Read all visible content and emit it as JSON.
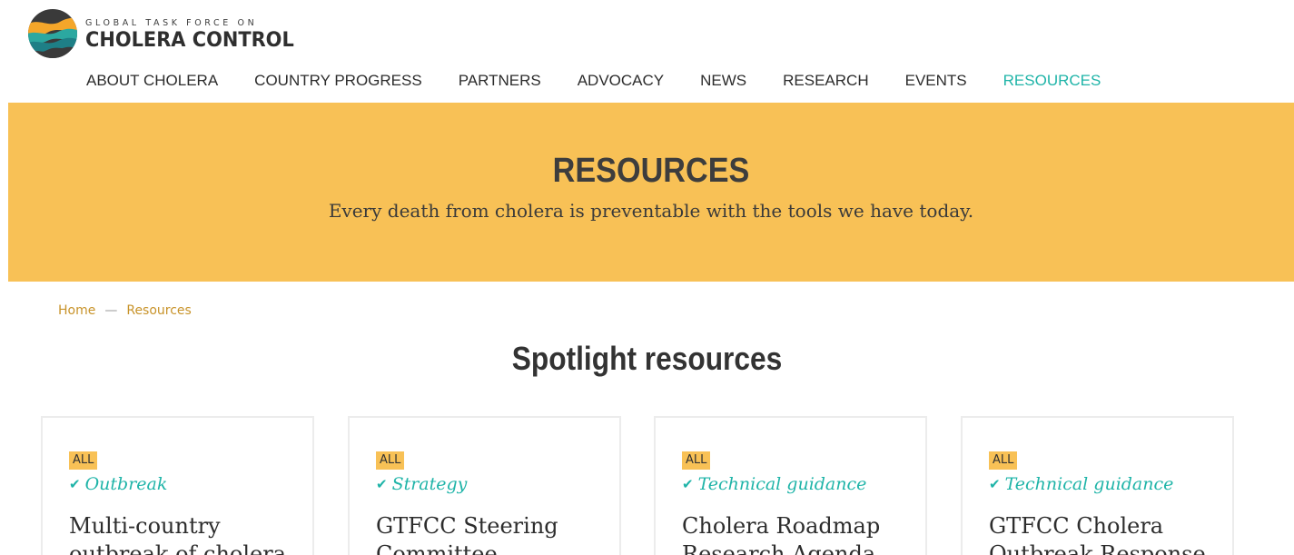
{
  "header": {
    "logo_small": "GLOBAL TASK FORCE ON",
    "logo_big": "CHOLERA CONTROL"
  },
  "nav": {
    "items": [
      {
        "label": "ABOUT CHOLERA"
      },
      {
        "label": "COUNTRY PROGRESS"
      },
      {
        "label": "PARTNERS"
      },
      {
        "label": "ADVOCACY"
      },
      {
        "label": "NEWS"
      },
      {
        "label": "RESEARCH"
      },
      {
        "label": "EVENTS"
      },
      {
        "label": "RESOURCES"
      }
    ],
    "active": "RESOURCES",
    "active_color": "#1fb4a8"
  },
  "hero": {
    "title": "RESOURCES",
    "subtitle": "Every death from cholera is preventable with the tools we have today.",
    "background": "#f8c156"
  },
  "breadcrumb": {
    "home": "Home",
    "separator": "—",
    "current": "Resources"
  },
  "section": {
    "title": "Spotlight resources"
  },
  "cards": [
    {
      "badge": "ALL",
      "tag": "Outbreak",
      "title": "Multi-country outbreak of cholera"
    },
    {
      "badge": "ALL",
      "tag": "Strategy",
      "title": "GTFCC Steering Committee"
    },
    {
      "badge": "ALL",
      "tag": "Technical guidance",
      "title": "Cholera Roadmap Research Agenda"
    },
    {
      "badge": "ALL",
      "tag": "Technical guidance",
      "title": "GTFCC Cholera Outbreak Response"
    }
  ],
  "icons": {
    "tag_icon": "check-icon",
    "logo_icon": "wave-logo-icon"
  }
}
